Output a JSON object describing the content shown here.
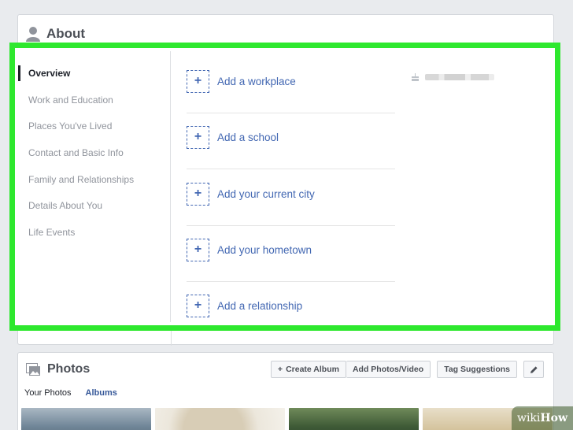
{
  "about": {
    "title": "About",
    "nav": [
      {
        "label": "Overview",
        "active": true
      },
      {
        "label": "Work and Education",
        "active": false
      },
      {
        "label": "Places You've Lived",
        "active": false
      },
      {
        "label": "Contact and Basic Info",
        "active": false
      },
      {
        "label": "Family and Relationships",
        "active": false
      },
      {
        "label": "Details About You",
        "active": false
      },
      {
        "label": "Life Events",
        "active": false
      }
    ],
    "add_items": [
      {
        "label": "Add a workplace"
      },
      {
        "label": "Add a school"
      },
      {
        "label": "Add your current city"
      },
      {
        "label": "Add your hometown"
      },
      {
        "label": "Add a relationship"
      }
    ],
    "plus_glyph": "+"
  },
  "photos": {
    "title": "Photos",
    "buttons": {
      "create_album": "Create Album",
      "add_photos_video": "Add Photos/Video",
      "tag_suggestions": "Tag Suggestions"
    },
    "tabs": [
      {
        "label": "Your Photos",
        "active": true
      },
      {
        "label": "Albums",
        "active": false
      }
    ]
  },
  "watermark": {
    "prefix": "wiki",
    "suffix": "How"
  },
  "colors": {
    "highlight": "#2ee82e",
    "link": "#4267b2"
  },
  "icons": [
    "person-icon",
    "plus-icon",
    "cake-icon",
    "photos-icon",
    "pencil-icon"
  ]
}
